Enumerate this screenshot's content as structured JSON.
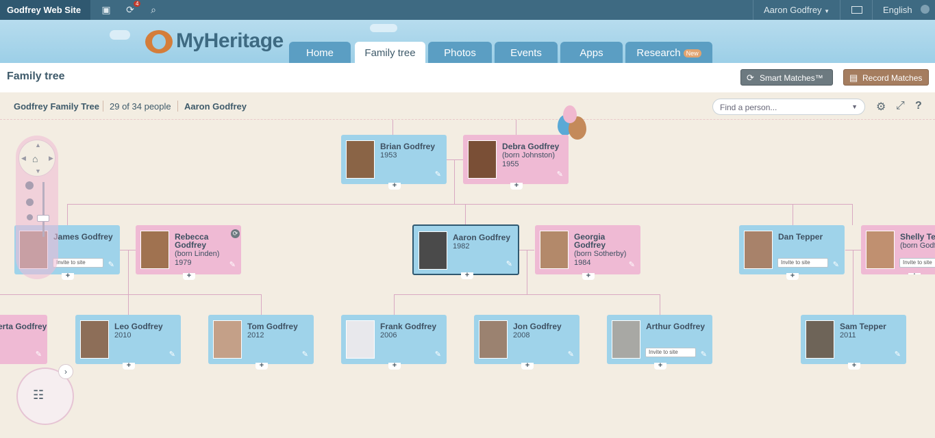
{
  "topbar": {
    "site_name": "Godfrey Web Site",
    "notification_count": "4",
    "user_name": "Aaron Godfrey",
    "language": "English"
  },
  "header": {
    "logo_text": "MyHeritage",
    "tabs": [
      {
        "label": "Home"
      },
      {
        "label": "Family tree"
      },
      {
        "label": "Photos"
      },
      {
        "label": "Events"
      },
      {
        "label": "Apps"
      },
      {
        "label": "Research",
        "badge": "New"
      }
    ]
  },
  "page": {
    "title": "Family tree",
    "smart_matches": "Smart Matches™",
    "record_matches": "Record Matches"
  },
  "info": {
    "tree_name": "Godfrey Family Tree",
    "people_count": "29 of 34 people",
    "root_person": "Aaron Godfrey",
    "search_placeholder": "Find a person..."
  },
  "people": {
    "brian": {
      "name": "Brian Godfrey",
      "year": "1953"
    },
    "debra": {
      "name": "Debra Godfrey",
      "maiden": "(born Johnston)",
      "year": "1955"
    },
    "james": {
      "name": "James Godfrey",
      "invite": "Invite to site"
    },
    "rebecca": {
      "name": "Rebecca Godfrey",
      "maiden": "(born Linden)",
      "year": "1979"
    },
    "aaron": {
      "name": "Aaron Godfrey",
      "year": "1982"
    },
    "georgia": {
      "name": "Georgia Godfrey",
      "maiden": "(born Sotherby)",
      "year": "1984"
    },
    "dan": {
      "name": "Dan Tepper",
      "invite": "Invite to site"
    },
    "shelly": {
      "name": "Shelly Te",
      "maiden": "(born Godf",
      "invite": "Invite to site"
    },
    "roberta": {
      "name": "erta Godfrey"
    },
    "leo": {
      "name": "Leo Godfrey",
      "year": "2010"
    },
    "tom": {
      "name": "Tom Godfrey",
      "year": "2012"
    },
    "frank": {
      "name": "Frank Godfrey",
      "year": "2006"
    },
    "jon": {
      "name": "Jon Godfrey",
      "year": "2008"
    },
    "arthur": {
      "name": "Arthur Godfrey",
      "invite": "Invite to site"
    },
    "sam": {
      "name": "Sam Tepper",
      "year": "2011"
    }
  },
  "colors": {
    "male_card": "#9fd3ea",
    "female_card": "#efbad4",
    "topbar": "#3e6a82",
    "accent": "#d47d3a"
  },
  "icons": [
    "notes-icon",
    "sync-icon",
    "search-icon",
    "mail-icon",
    "globe-icon",
    "gear-icon",
    "fullscreen-icon",
    "help-icon",
    "home-icon",
    "tree-icon",
    "pencil-icon",
    "plus-icon"
  ]
}
